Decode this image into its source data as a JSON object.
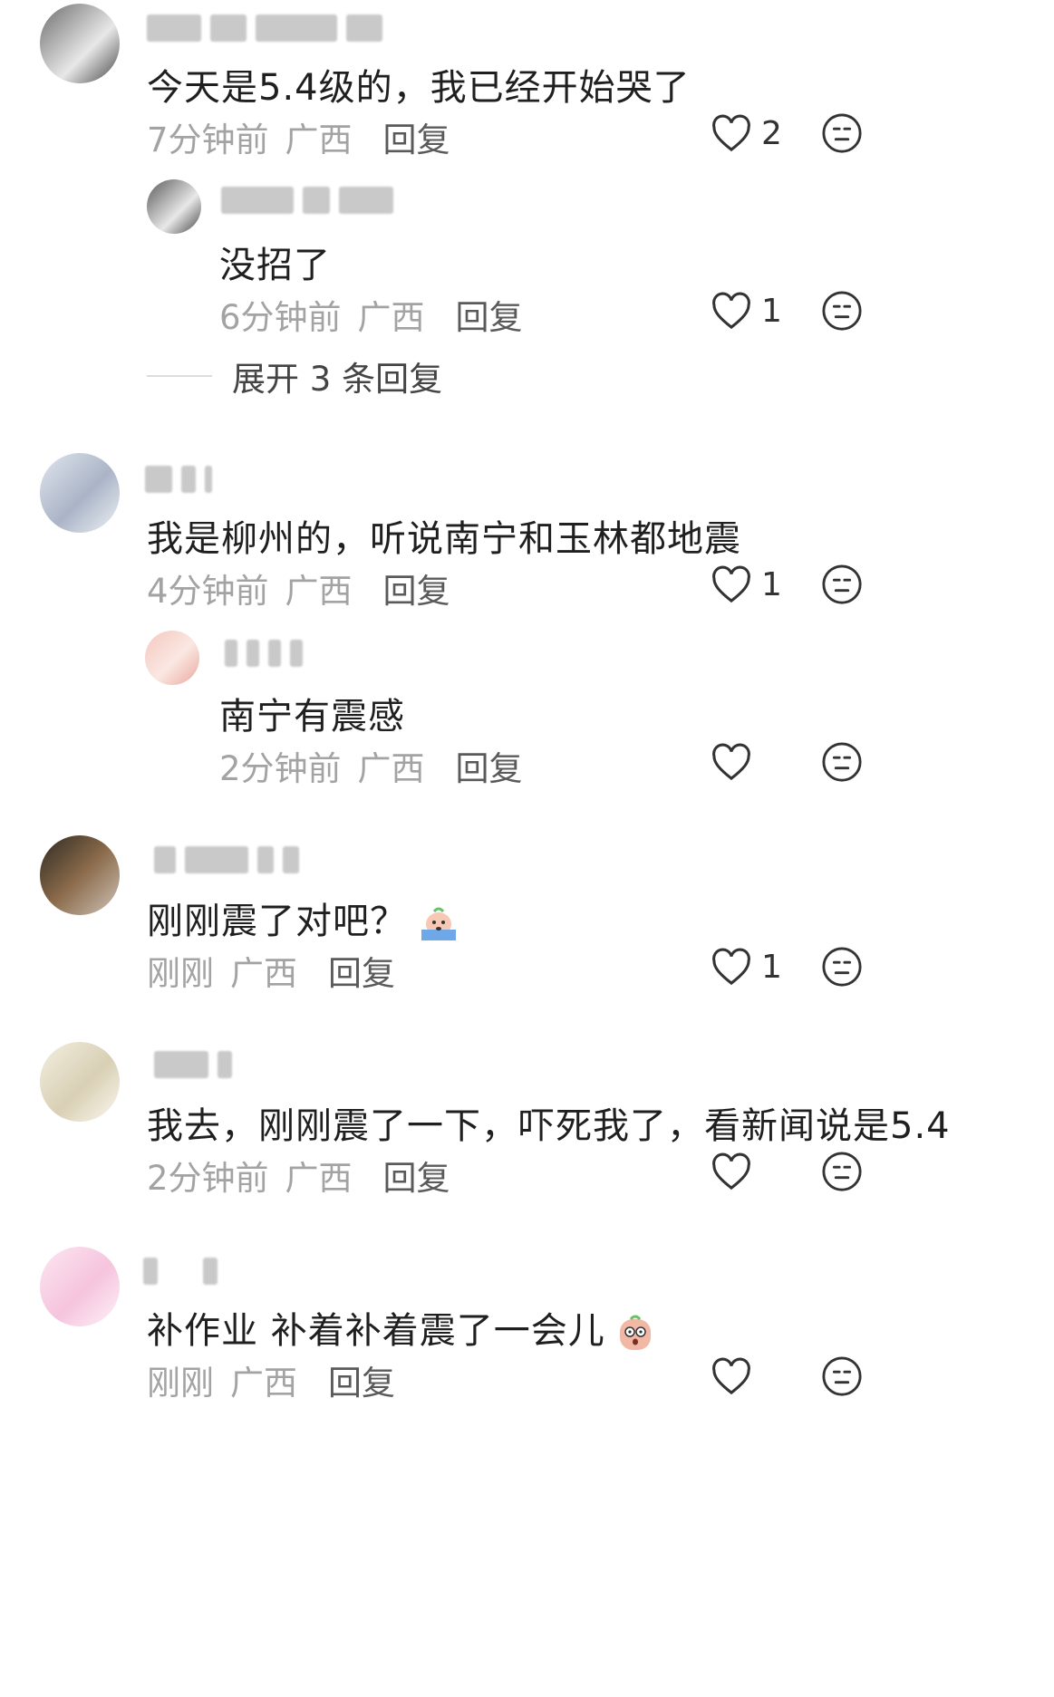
{
  "comments": [
    {
      "text": "今天是5.4级的，我已经开始哭了",
      "time": "7分钟前",
      "location": "广西",
      "reply": "回复",
      "likes": "2"
    },
    {
      "text": "没招了",
      "time": "6分钟前",
      "location": "广西",
      "reply": "回复",
      "likes": "1"
    },
    {
      "text": "我是柳州的，听说南宁和玉林都地震",
      "time": "4分钟前",
      "location": "广西",
      "reply": "回复",
      "likes": "1"
    },
    {
      "text": "南宁有震感",
      "time": "2分钟前",
      "location": "广西",
      "reply": "回复",
      "likes": ""
    },
    {
      "text": "刚刚震了对吧？",
      "time": "刚刚",
      "location": "广西",
      "reply": "回复",
      "likes": "1"
    },
    {
      "text": "我去，刚刚震了一下，吓死我了，看新闻说是5.4",
      "time": "2分钟前",
      "location": "广西",
      "reply": "回复",
      "likes": ""
    },
    {
      "text": "补作业 补着补着震了一会儿",
      "time": "刚刚",
      "location": "广西",
      "reply": "回复",
      "likes": ""
    }
  ],
  "expand_replies": "展开 3 条回复",
  "icons": {
    "like": "heart-outline-icon",
    "dislike": "neutral-face-icon",
    "emoji_cry": "crying-face-emoji",
    "emoji_shock": "shocked-face-emoji"
  },
  "colors": {
    "text": "#1f1f1f",
    "meta": "#a3a3a3",
    "reply": "#5a5a5a"
  }
}
